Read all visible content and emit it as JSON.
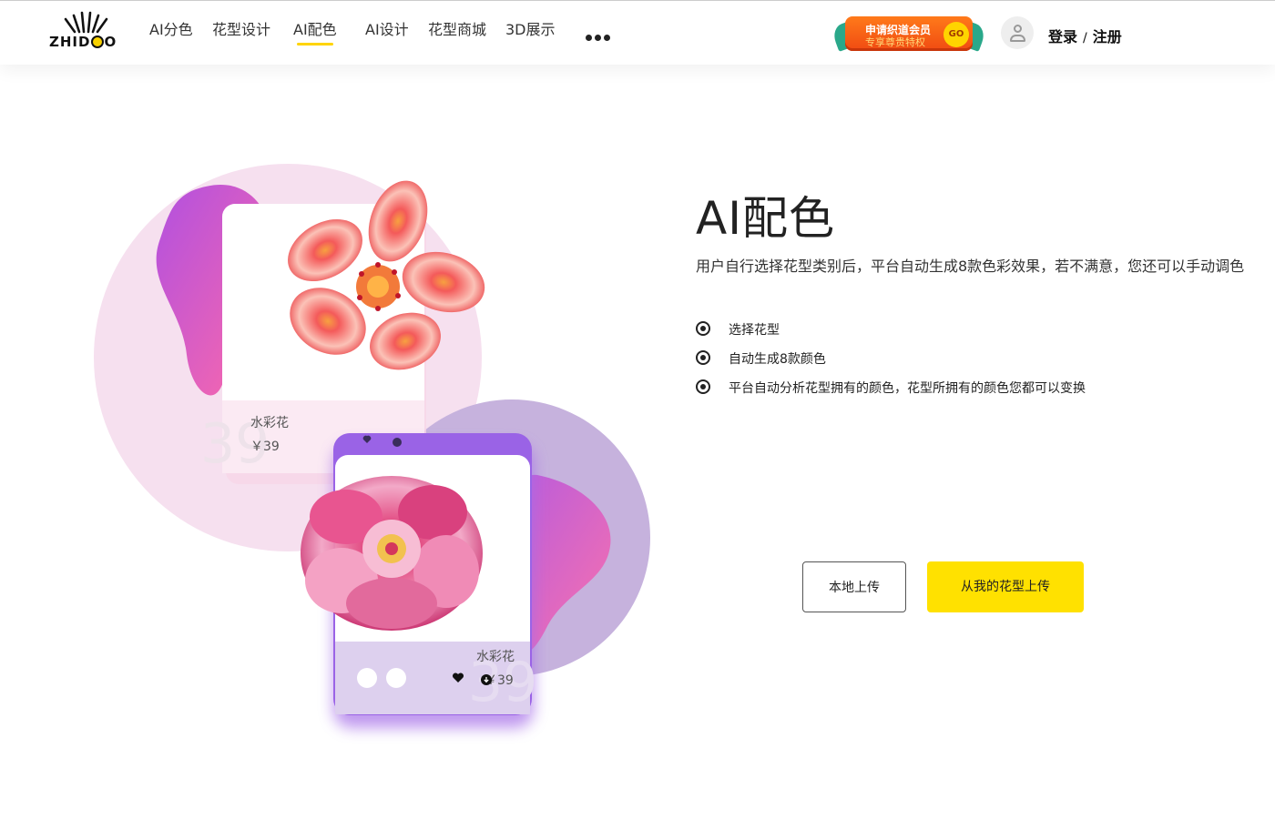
{
  "brand": {
    "logo_text": "ZHIDAO"
  },
  "nav": {
    "items": [
      {
        "label": "AI分色"
      },
      {
        "label": "花型设计"
      },
      {
        "label": "AI配色"
      },
      {
        "label": "AI设计"
      },
      {
        "label": "花型商城"
      },
      {
        "label": "3D展示"
      }
    ],
    "active_index": 2
  },
  "vip_banner": {
    "line1": "申请织道会员",
    "line2": "专享尊贵特权",
    "go": "GO"
  },
  "auth": {
    "login": "登录",
    "separator": "/",
    "register": "注册"
  },
  "main": {
    "title": "AI配色",
    "description": "用户自行选择花型类别后，平台自动生成8款色彩效果，若不满意，您还可以手动调色",
    "features": [
      "选择花型",
      "自动生成8款颜色",
      "平台自动分析花型拥有的颜色，花型所拥有的颜色您都可以变换"
    ],
    "buttons": {
      "local_upload": "本地上传",
      "my_pattern_upload": "从我的花型上传"
    }
  },
  "illustration": {
    "card_back": {
      "name": "水彩花",
      "price": "￥39"
    },
    "card_front": {
      "name": "水彩花",
      "price": "￥39"
    }
  },
  "colors": {
    "accent": "#ffe100",
    "nav_underline": "#ffd400",
    "vip_orange": "#f04a12"
  }
}
